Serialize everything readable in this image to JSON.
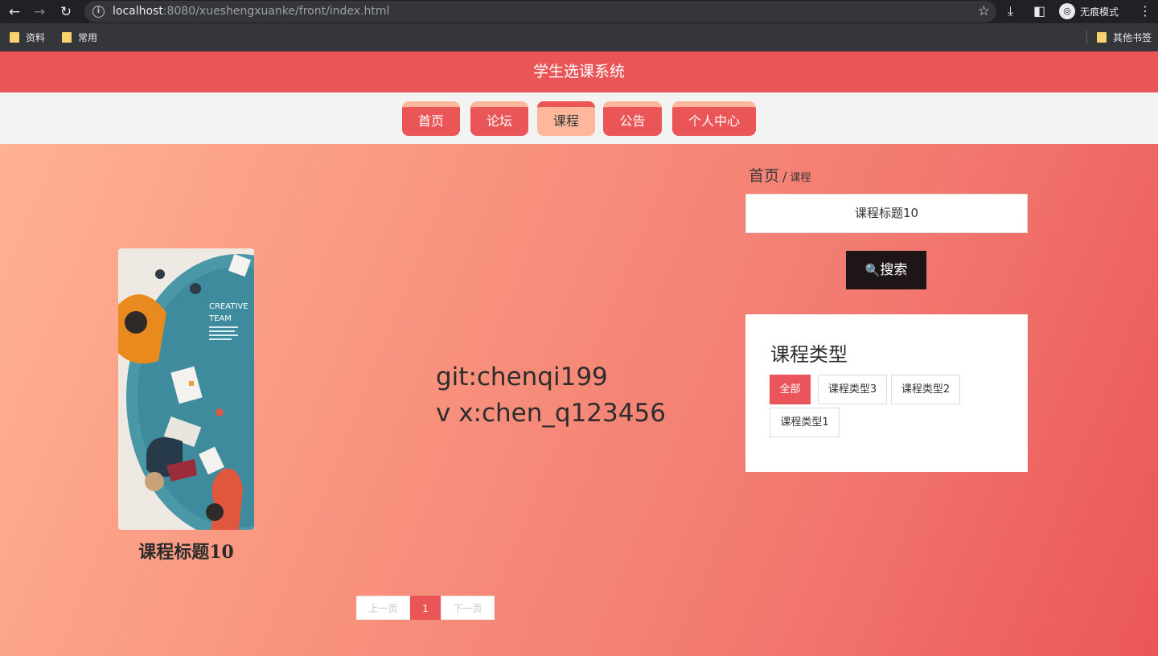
{
  "browser": {
    "url_host": "localhost",
    "url_rest": ":8080/xueshengxuanke/front/index.html",
    "incognito_label": "无痕模式",
    "bookmarks": [
      "资料",
      "常用"
    ],
    "other_bookmarks": "其他书签"
  },
  "site": {
    "title": "学生选课系统",
    "nav": [
      "首页",
      "论坛",
      "课程",
      "公告",
      "个人中心"
    ],
    "active_nav": "课程"
  },
  "breadcrumb": {
    "home": "首页",
    "separator": "/",
    "current": "课程"
  },
  "search": {
    "value": "课程标题10",
    "button_label": "搜索"
  },
  "course_types": {
    "title": "课程类型",
    "tags": [
      "全部",
      "课程类型3",
      "课程类型2",
      "课程类型1"
    ],
    "active": "全部"
  },
  "courses": [
    {
      "title": "课程标题10",
      "image_text": "CREATIVE TEAM"
    }
  ],
  "watermark": {
    "line1": "git:chenqi199",
    "line2": "v x:chen_q123456"
  },
  "pagination": {
    "prev": "上一页",
    "current": "1",
    "next": "下一页"
  },
  "colors": {
    "primary": "#ea5558",
    "accent": "#ffb79c",
    "dark_button": "#1e1516"
  }
}
